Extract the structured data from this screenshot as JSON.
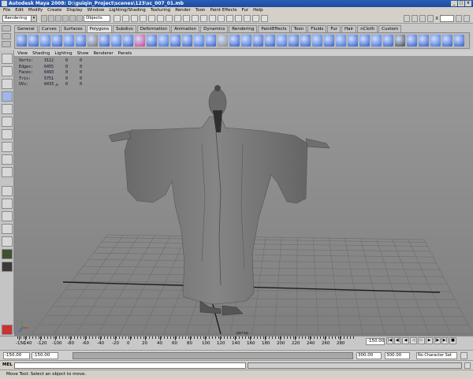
{
  "window": {
    "title": "Autodesk Maya 2008: D:\\guiqin_Project\\scenes\\123\\sc_007_01.mb"
  },
  "menubar": [
    "File",
    "Edit",
    "Modify",
    "Create",
    "Display",
    "Window",
    "Lighting/Shading",
    "Texturing",
    "Render",
    "Toon",
    "Paint Effects",
    "Fur",
    "Help"
  ],
  "status_line": {
    "mode": "Rendering",
    "selection_field": "Objects"
  },
  "shelf_tabs": [
    "General",
    "Curves",
    "Surfaces",
    "Polygons",
    "Subdivs",
    "Deformation",
    "Animation",
    "Dynamics",
    "Rendering",
    "PaintEffects",
    "Toon",
    "Fluids",
    "Fur",
    "Hair",
    "nCloth",
    "Custom"
  ],
  "active_shelf_tab": "Polygons",
  "panel_menu": [
    "View",
    "Shading",
    "Lighting",
    "Show",
    "Renderer",
    "Panels"
  ],
  "hud": [
    {
      "label": "Verts:",
      "value": "3112",
      "v2": "0",
      "v3": "0"
    },
    {
      "label": "Edges:",
      "value": "6455",
      "v2": "0",
      "v3": "0"
    },
    {
      "label": "Faces:",
      "value": "6493",
      "v2": "0",
      "v3": "0"
    },
    {
      "label": "Tris:",
      "value": "5751",
      "v2": "0",
      "v3": "0"
    },
    {
      "label": "UVs:",
      "value": "6433",
      "v2": "0",
      "v3": "0"
    }
  ],
  "camera_label": "persp",
  "timeline": {
    "ticks": [
      "-150",
      "-140",
      "-120",
      "-100",
      "-80",
      "-60",
      "-40",
      "-20",
      "0",
      "20",
      "40",
      "60",
      "80",
      "100",
      "120",
      "140",
      "160",
      "180",
      "200",
      "220",
      "240",
      "260",
      "280"
    ],
    "current_frame": "-150.00"
  },
  "range": {
    "start": "-150.00",
    "inner_start": "-150.00",
    "inner_end": "300.00",
    "end": "300.00",
    "character_set": "No Character Set"
  },
  "command_line": {
    "label": "MEL"
  },
  "help_line": "Move Tool: Select an object to move."
}
